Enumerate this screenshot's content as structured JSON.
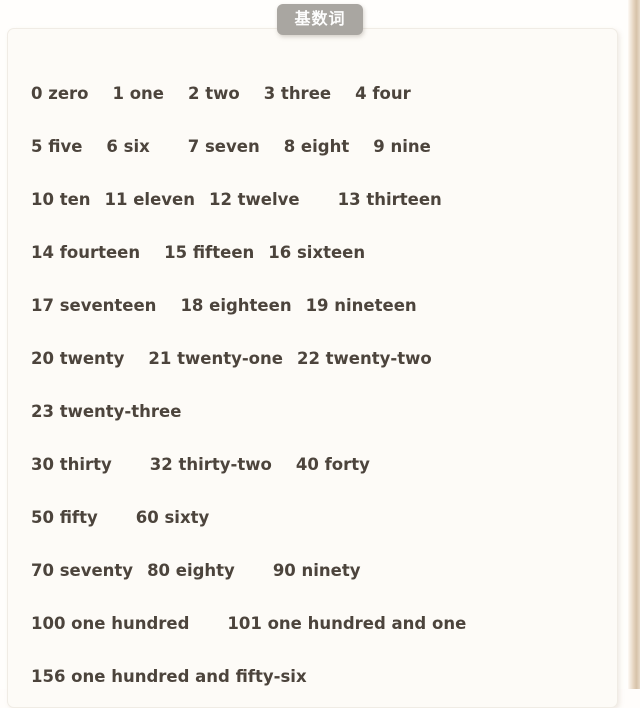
{
  "badge": {
    "label": "基数词",
    "background_color": "#a9a6a1",
    "text_color": "#fdfdfd"
  },
  "card": {
    "background_color": "#fdfbf7",
    "border_color": "#f0ece5"
  },
  "text_color": "#4c443c",
  "rows": [
    {
      "items": [
        "0 zero",
        "1 one",
        "2 two",
        "3 three",
        "4 four"
      ],
      "gaps": [
        "md",
        "md",
        "md",
        "md"
      ]
    },
    {
      "items": [
        "5 five",
        "6 six",
        "7 seven",
        "8 eight",
        "9 nine"
      ],
      "gaps": [
        "md",
        "lg",
        "md",
        "md"
      ]
    },
    {
      "items": [
        "10 ten",
        "11 eleven",
        "12 twelve",
        "13 thirteen"
      ],
      "gaps": [
        "sm",
        "sm",
        "lg"
      ]
    },
    {
      "items": [
        "14 fourteen",
        "15 fifteen",
        "16 sixteen"
      ],
      "gaps": [
        "md",
        "sm"
      ]
    },
    {
      "items": [
        "17 seventeen",
        "18 eighteen",
        "19 nineteen"
      ],
      "gaps": [
        "md",
        "sm"
      ]
    },
    {
      "items": [
        "20 twenty",
        "21 twenty-one",
        "22 twenty-two"
      ],
      "gaps": [
        "md",
        "sm"
      ]
    },
    {
      "items": [
        "23 twenty-three"
      ],
      "gaps": []
    },
    {
      "items": [
        "30 thirty",
        "32 thirty-two",
        "40 forty"
      ],
      "gaps": [
        "lg",
        "md"
      ]
    },
    {
      "items": [
        "50 fifty",
        "60 sixty"
      ],
      "gaps": [
        "lg"
      ]
    },
    {
      "items": [
        "70 seventy",
        "80 eighty",
        "90 ninety"
      ],
      "gaps": [
        "sm",
        "lg"
      ]
    },
    {
      "items": [
        "100 one hundred",
        "101 one hundred and one"
      ],
      "gaps": [
        "lg"
      ]
    },
    {
      "items": [
        "156 one hundred and fifty-six"
      ],
      "gaps": []
    }
  ]
}
